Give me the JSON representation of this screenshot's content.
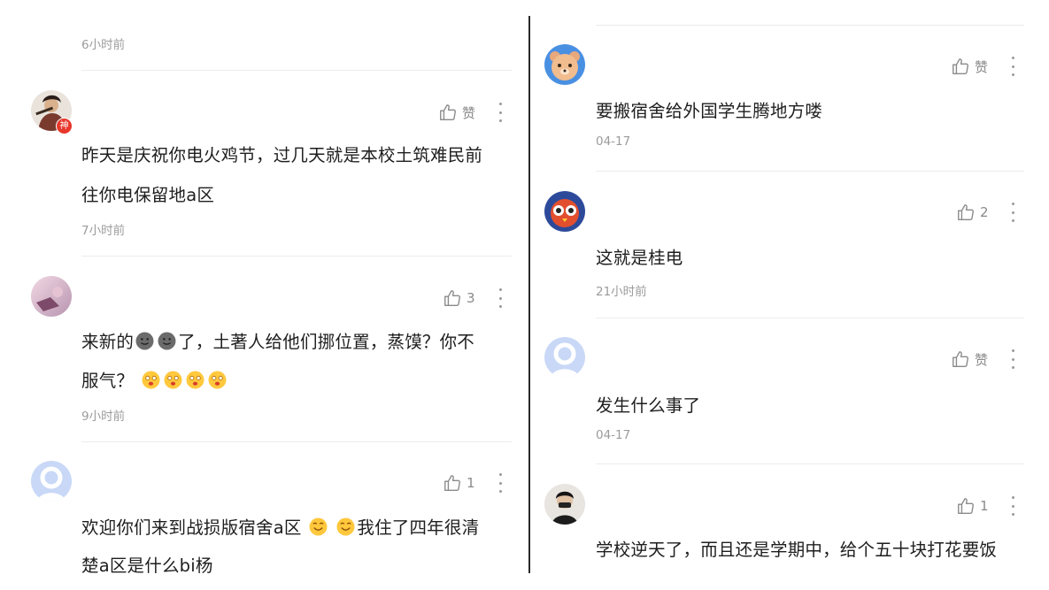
{
  "left": {
    "partial_prev": {
      "time": "6小时前"
    },
    "comments": [
      {
        "like": "赞",
        "lines": [
          "昨天是庆祝你电火鸡节，过几天就是本校土筑难民前",
          "往你电保留地a区"
        ],
        "time": "7小时前",
        "avatar_badge": "神"
      },
      {
        "like": "3",
        "line1_prefix": "来新的",
        "line1_suffix": "了，土著人给他们挪位置，蒸馍？你不",
        "line2_prefix": "服气？",
        "time": "9小时前"
      },
      {
        "like": "1",
        "line1_prefix": "欢迎你们来到战损版宿舍a区",
        "line1_suffix": "我住了四年很清",
        "line2": "楚a区是什么bi杨"
      }
    ]
  },
  "right": {
    "comments": [
      {
        "like": "赞",
        "lines": [
          "要搬宿舍给外国学生腾地方喽"
        ],
        "time": "04-17"
      },
      {
        "like": "2",
        "lines": [
          "这就是桂电"
        ],
        "time": "21小时前"
      },
      {
        "like": "赞",
        "lines": [
          "发生什么事了"
        ],
        "time": "04-17"
      },
      {
        "like": "1",
        "lines": [
          "学校逆天了，而且还是学期中，给个五十块打花要饭"
        ]
      }
    ]
  },
  "icons": {
    "like": "thumbs-up-icon",
    "more": "more-vertical-icon"
  },
  "colors": {
    "text": "#1e1e1e",
    "meta": "#9b9b9b",
    "icon": "#8a8a8a",
    "separator": "#ececec"
  }
}
